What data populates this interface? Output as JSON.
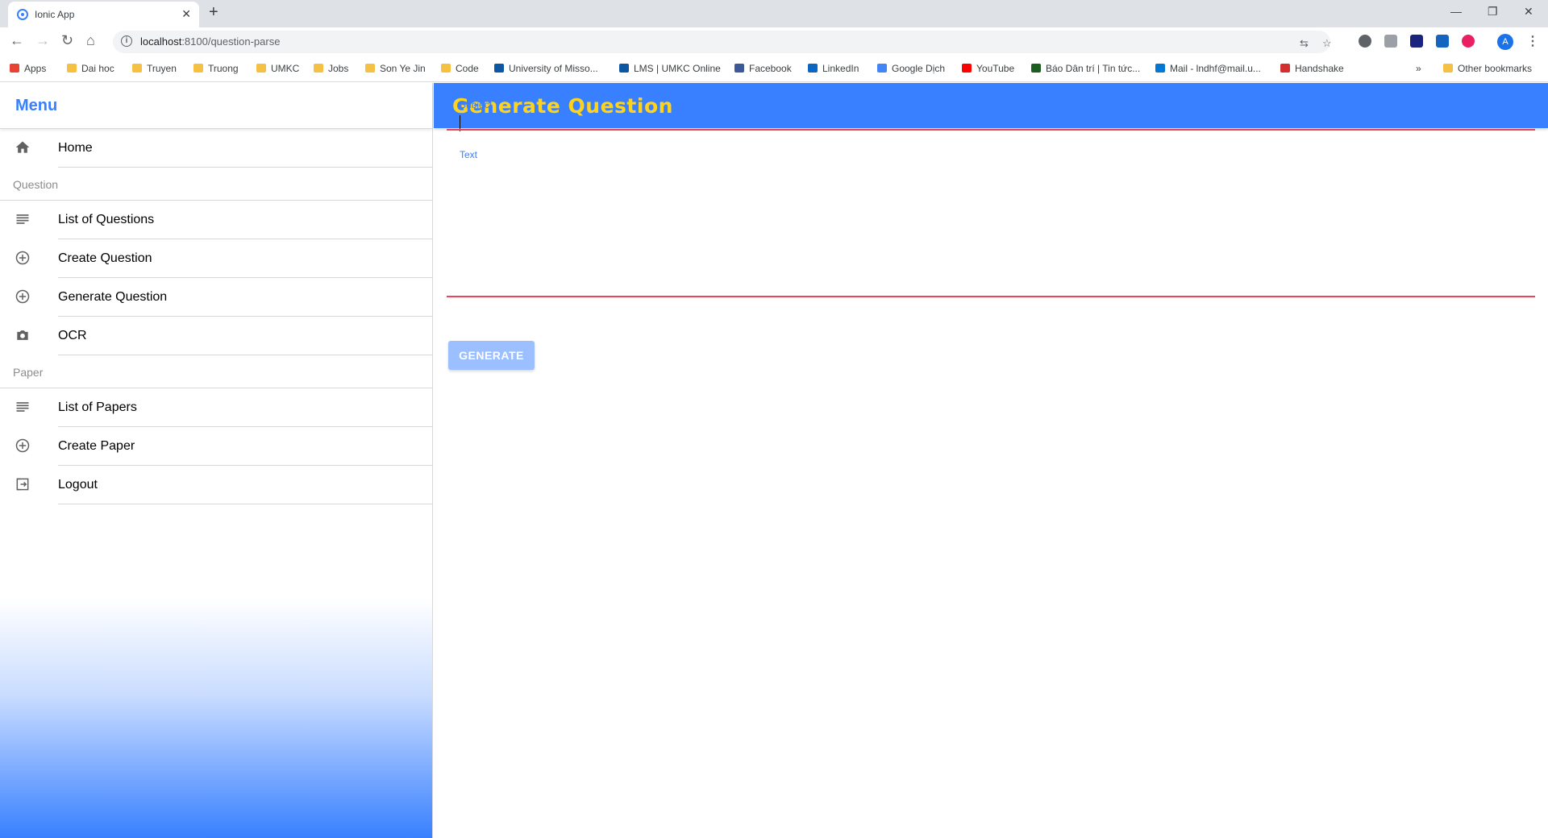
{
  "browser": {
    "tab_title": "Ionic App",
    "url_host": "localhost",
    "url_path": ":8100/question-parse",
    "avatar_letter": "A",
    "bookmarks": [
      {
        "label": "Apps",
        "icon": "apps-grid-icon",
        "color": "#e94235"
      },
      {
        "label": "Dai hoc",
        "icon": "folder-icon",
        "color": "#f6c142"
      },
      {
        "label": "Truyen",
        "icon": "folder-icon",
        "color": "#f6c142"
      },
      {
        "label": "Truong",
        "icon": "folder-icon",
        "color": "#f6c142"
      },
      {
        "label": "UMKC",
        "icon": "folder-icon",
        "color": "#f6c142"
      },
      {
        "label": "Jobs",
        "icon": "folder-icon",
        "color": "#f6c142"
      },
      {
        "label": "Son Ye Jin",
        "icon": "folder-icon",
        "color": "#f6c142"
      },
      {
        "label": "Code",
        "icon": "folder-icon",
        "color": "#f6c142"
      },
      {
        "label": "University of Misso...",
        "icon": "umkc-icon",
        "color": "#0b57a4"
      },
      {
        "label": "LMS | UMKC Online",
        "icon": "lms-icon",
        "color": "#0b57a4"
      },
      {
        "label": "Facebook",
        "icon": "facebook-icon",
        "color": "#3b5998"
      },
      {
        "label": "LinkedIn",
        "icon": "linkedin-icon",
        "color": "#0a66c2"
      },
      {
        "label": "Google Dịch",
        "icon": "google-translate-icon",
        "color": "#4285f4"
      },
      {
        "label": "YouTube",
        "icon": "youtube-icon",
        "color": "#ff0000"
      },
      {
        "label": "Báo Dân trí | Tin tức...",
        "icon": "dantri-icon",
        "color": "#1b5e20"
      },
      {
        "label": "Mail - lndhf@mail.u...",
        "icon": "outlook-icon",
        "color": "#0078d4"
      },
      {
        "label": "Handshake",
        "icon": "handshake-icon",
        "color": "#d32f2f"
      }
    ],
    "more_bookmarks": "»",
    "other_bookmarks": "Other bookmarks"
  },
  "menu": {
    "title": "Menu",
    "home": "Home",
    "section_question": "Question",
    "question_items": [
      {
        "label": "List of Questions",
        "icon": "list-icon"
      },
      {
        "label": "Create Question",
        "icon": "add-circle-icon"
      },
      {
        "label": "Generate Question",
        "icon": "add-circle-icon"
      },
      {
        "label": "OCR",
        "icon": "camera-icon"
      }
    ],
    "section_paper": "Paper",
    "paper_items": [
      {
        "label": "List of Papers",
        "icon": "list-icon"
      },
      {
        "label": "Create Paper",
        "icon": "add-circle-icon"
      },
      {
        "label": "Logout",
        "icon": "logout-icon"
      }
    ]
  },
  "page": {
    "title": "Generate Question",
    "subject_label": "Subject",
    "subject_value": "",
    "text_label": "Text",
    "text_value": "",
    "generate_button": "GENERATE"
  },
  "colors": {
    "primary": "#3880ff",
    "title_yellow": "#ffd31a",
    "danger_underline": "#eb445a",
    "button_disabled": "#9cbfff"
  }
}
